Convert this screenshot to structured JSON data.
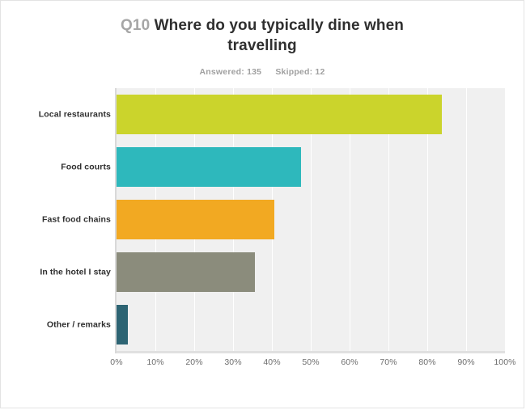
{
  "title": {
    "question_number": "Q10",
    "question_text": "Where do you typically dine when travelling"
  },
  "subtitle": {
    "answered": "Answered: 135",
    "skipped": "Skipped: 12"
  },
  "colors": {
    "local_restaurants": "#cbd42c",
    "food_courts": "#2eb8bc",
    "fast_food_chains": "#f2a922",
    "in_the_hotel_i_stay": "#8b8c7c",
    "other_remarks": "#2d6473",
    "plot_background": "#f0f0f0",
    "gridline": "#ffffff",
    "title_dark": "#2f2f2f",
    "title_muted": "#a6a6a6",
    "subtitle": "#a0a0a0",
    "tick_label": "#6e6e6e"
  },
  "chart_data": {
    "type": "bar",
    "orientation": "horizontal",
    "title": "Q10 Where do you typically dine when travelling",
    "subtitle": "Answered: 135    Skipped: 12",
    "xlabel": "",
    "ylabel": "",
    "xlim": [
      0,
      100
    ],
    "xticks": [
      "0%",
      "10%",
      "20%",
      "30%",
      "40%",
      "50%",
      "60%",
      "70%",
      "80%",
      "90%",
      "100%"
    ],
    "xtick_values": [
      0,
      10,
      20,
      30,
      40,
      50,
      60,
      70,
      80,
      90,
      100
    ],
    "grid": true,
    "legend": "none",
    "categories": [
      "Local restaurants",
      "Food courts",
      "Fast food chains",
      "In the hotel I stay",
      "Other / remarks"
    ],
    "values": [
      83.7,
      47.4,
      40.7,
      35.6,
      2.9
    ],
    "bars": [
      {
        "label": "Local restaurants",
        "value": 83.7,
        "color": "#cbd42c"
      },
      {
        "label": "Food courts",
        "value": 47.4,
        "color": "#2eb8bc"
      },
      {
        "label": "Fast food chains",
        "value": 40.7,
        "color": "#f2a922"
      },
      {
        "label": "In the hotel I stay",
        "value": 35.6,
        "color": "#8b8c7c"
      },
      {
        "label": "Other / remarks",
        "value": 2.9,
        "color": "#2d6473"
      }
    ]
  }
}
